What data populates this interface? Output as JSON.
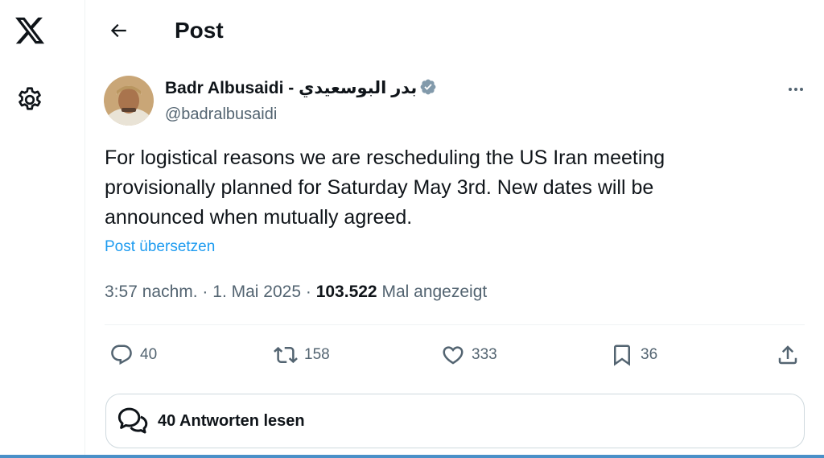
{
  "header": {
    "title": "Post"
  },
  "author": {
    "name": "Badr Albusaidi - بدر البوسعيدي",
    "handle": "@badralbusaidi",
    "verified": true
  },
  "post": {
    "text": "For logistical reasons we are rescheduling the US Iran meeting provisionally planned for Saturday May 3rd. New dates will be announced when mutually agreed.",
    "translate_label": "Post übersetzen",
    "time": "3:57 nachm.",
    "separator": "·",
    "date": "1. Mai 2025",
    "views_count": "103.522",
    "views_label": "Mal angezeigt"
  },
  "actions": {
    "replies": "40",
    "reposts": "158",
    "likes": "333",
    "bookmarks": "36"
  },
  "read_replies_label": "40 Antworten lesen",
  "icons": {
    "logo": "x-logo",
    "settings": "gear-icon",
    "back": "arrow-left-icon",
    "more": "more-horizontal-icon",
    "reply": "reply-icon",
    "repost": "repost-icon",
    "like": "heart-icon",
    "bookmark": "bookmark-icon",
    "share": "share-icon",
    "replies": "chat-bubbles-icon"
  },
  "colors": {
    "link": "#1d9bf0",
    "secondary_text": "#536471",
    "primary_text": "#0f1419",
    "verified_badge": "#829aab"
  }
}
